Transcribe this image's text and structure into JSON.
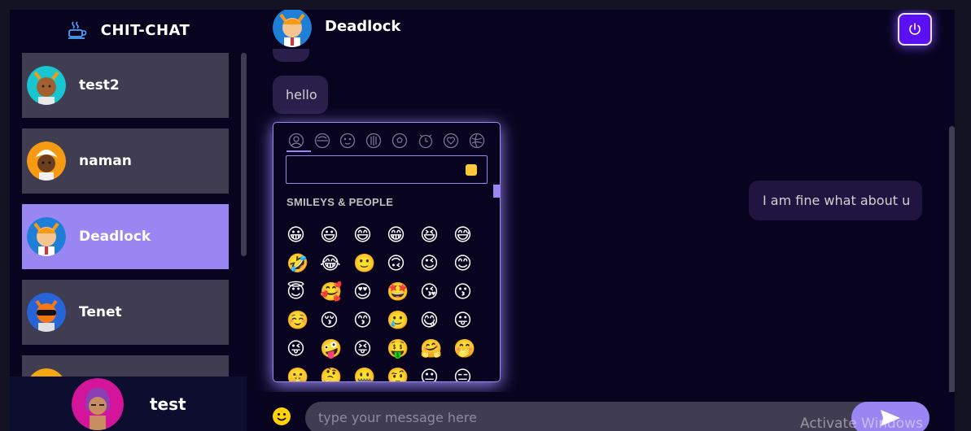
{
  "brand": {
    "title": "CHIT-CHAT",
    "icon": "coffee-cup-icon"
  },
  "contacts": [
    {
      "name": "test2",
      "avatar_bg": "#18c6d1",
      "selected": false
    },
    {
      "name": "naman",
      "avatar_bg": "#f59a12",
      "selected": false
    },
    {
      "name": "Deadlock",
      "avatar_bg": "#1e7fd8",
      "selected": true
    },
    {
      "name": "Tenet",
      "avatar_bg": "#2764d8",
      "selected": false
    },
    {
      "name": "",
      "avatar_bg": "#f5a613",
      "selected": false
    }
  ],
  "current_user": {
    "name": "test",
    "avatar_bg": "#d4149a"
  },
  "chat": {
    "contact_name": "Deadlock",
    "logout_icon": "power-icon",
    "messages": [
      {
        "text": "",
        "direction": "received"
      },
      {
        "text": "hello",
        "direction": "received"
      },
      {
        "text": "I am fine what about u",
        "direction": "sent"
      }
    ]
  },
  "emoji_picker": {
    "tabs": [
      "person-icon",
      "food-icon",
      "animal-icon",
      "building-icon",
      "ball-icon",
      "clock-icon",
      "heart-icon",
      "flag-icon"
    ],
    "search_value": "",
    "section_title": "SMILEYS & PEOPLE",
    "emojis": [
      "😀",
      "😃",
      "😄",
      "😁",
      "😆",
      "😅",
      "🤣",
      "😂",
      "🙂",
      "🙃",
      "😉",
      "😊",
      "😇",
      "🥰",
      "😍",
      "🤩",
      "😘",
      "😗",
      "☺️",
      "😚",
      "😙",
      "🥲",
      "😋",
      "😛",
      "😜",
      "🤪",
      "😝",
      "🤑",
      "🤗",
      "🤭",
      "🤫",
      "🤔",
      "🤐",
      "🤨",
      "😐",
      "😑"
    ]
  },
  "input_bar": {
    "placeholder": "type your message here",
    "send_icon": "send-arrow-icon",
    "emoji_icon": "smiley-icon"
  },
  "watermark": "Activate Windows",
  "colors": {
    "accent": "#9a86f3",
    "background": "#131324",
    "panel": "#080420",
    "contact_bg": "#403d52",
    "logout": "#5a0ff5"
  }
}
